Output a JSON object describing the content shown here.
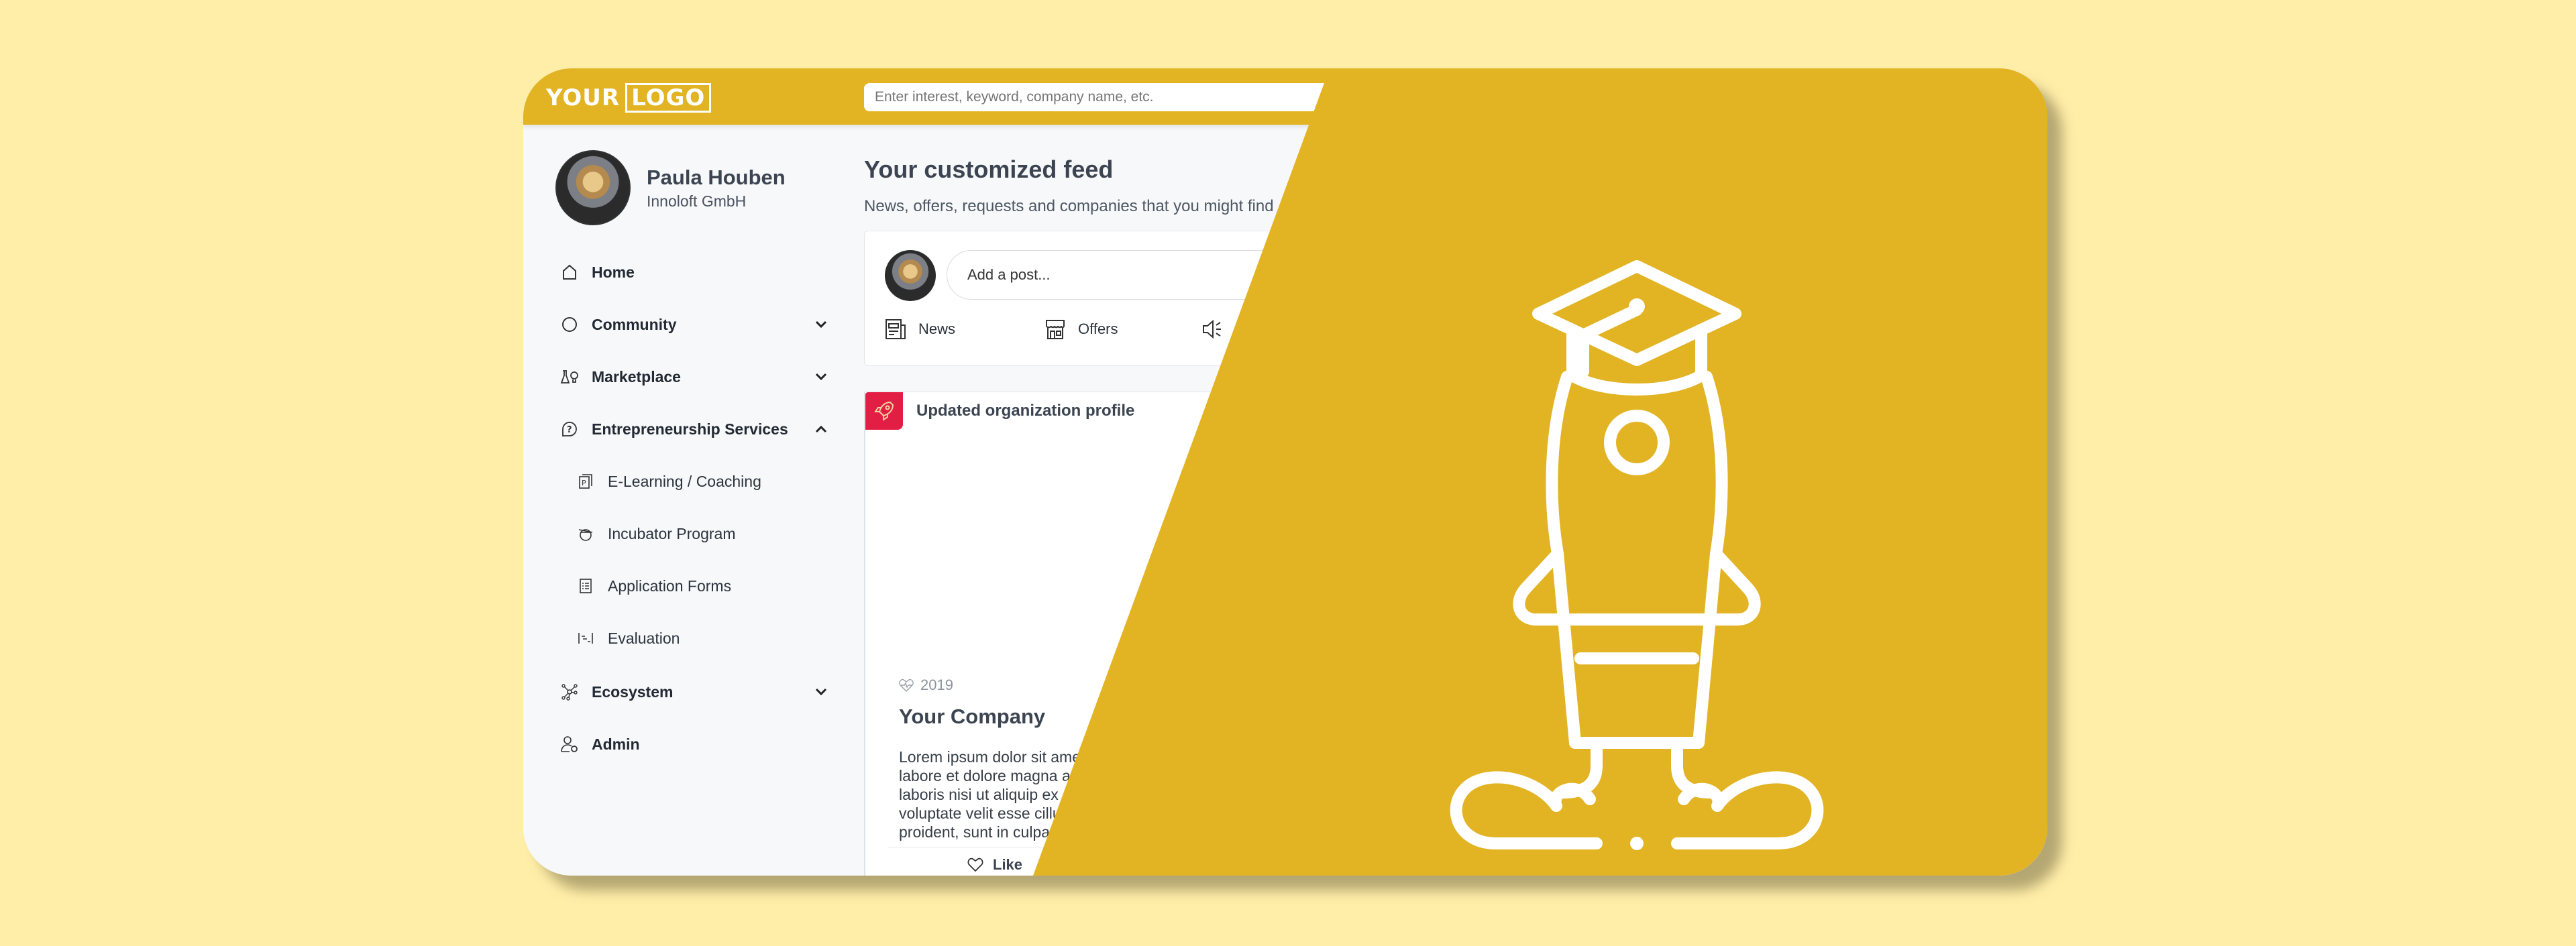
{
  "colors": {
    "background": "#FFEEA8",
    "brand": "#E2B323",
    "accent_red": "#E31E44",
    "sidebar_bg": "#F6F8FA"
  },
  "header": {
    "logo_word1": "YOUR",
    "logo_word2": "LOGO",
    "search_placeholder": "Enter interest, keyword, company name, etc."
  },
  "profile": {
    "name": "Paula Houben",
    "company": "Innoloft GmbH"
  },
  "sidebar": {
    "items": [
      {
        "label": "Home",
        "icon": "home-icon"
      },
      {
        "label": "Community",
        "icon": "circle-icon",
        "expandable": true,
        "expanded": false
      },
      {
        "label": "Marketplace",
        "icon": "flask-bulb-icon",
        "expandable": true,
        "expanded": false
      },
      {
        "label": "Entrepreneurship Services",
        "icon": "question-bubble-icon",
        "expandable": true,
        "expanded": true
      },
      {
        "label": "E-Learning / Coaching",
        "icon": "presentation-icon",
        "sub": true
      },
      {
        "label": "Incubator Program",
        "icon": "incubator-icon",
        "sub": true
      },
      {
        "label": "Application Forms",
        "icon": "form-list-icon",
        "sub": true
      },
      {
        "label": "Evaluation",
        "icon": "evaluation-icon",
        "sub": true
      },
      {
        "label": "Ecosystem",
        "icon": "network-icon",
        "expandable": true,
        "expanded": false
      },
      {
        "label": "Admin",
        "icon": "user-gear-icon"
      }
    ]
  },
  "feed": {
    "title": "Your customized feed",
    "subtitle": "News, offers, requests and companies that you might find",
    "composer": {
      "placeholder": "Add a post...",
      "tabs": [
        {
          "label": "News",
          "icon": "newspaper-icon"
        },
        {
          "label": "Offers",
          "icon": "storefront-icon"
        },
        {
          "label": "",
          "icon": "megaphone-icon"
        }
      ]
    },
    "activity": {
      "title": "Updated organization profile",
      "year": "2019",
      "company": "Your Company",
      "description": "Lorem ipsum dolor sit ame\nlabore et dolore magna a\nlaboris nisi ut aliquip ex\nvoluptate velit esse cillu\nproident, sunt in culpa",
      "like_label": "Like"
    }
  },
  "hero_icon": "rocket-graduation-cap-icon"
}
